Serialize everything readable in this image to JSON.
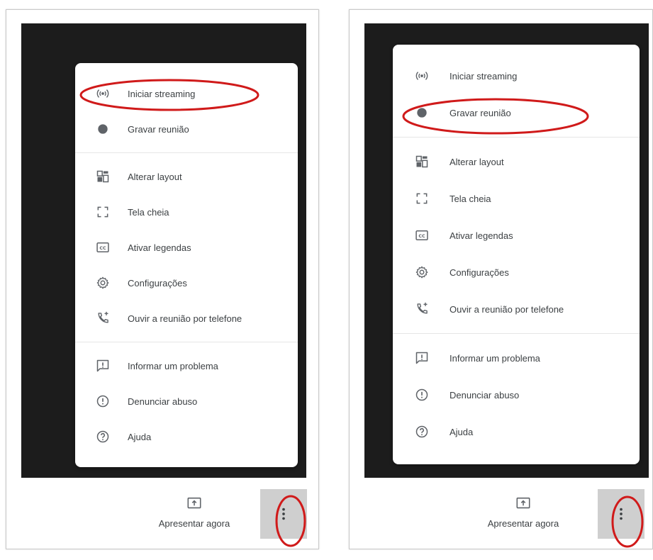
{
  "colors": {
    "video_bg": "#1c1c1c",
    "menu_bg": "#ffffff",
    "text": "#3c4043",
    "annotation": "#d01a1a",
    "more_button_bg": "#cfcfcf"
  },
  "panels": [
    {
      "menu": {
        "group1": [
          {
            "label": "Iniciar streaming",
            "icon": "streaming-icon"
          },
          {
            "label": "Gravar reunião",
            "icon": "record-icon"
          }
        ],
        "group2": [
          {
            "label": "Alterar layout",
            "icon": "layout-icon"
          },
          {
            "label": "Tela cheia",
            "icon": "fullscreen-icon"
          },
          {
            "label": "Ativar legendas",
            "icon": "captions-icon"
          },
          {
            "label": "Configurações",
            "icon": "settings-icon"
          },
          {
            "label": "Ouvir a reunião por telefone",
            "icon": "phone-icon"
          }
        ],
        "group3": [
          {
            "label": "Informar um problema",
            "icon": "feedback-icon"
          },
          {
            "label": "Denunciar abuso",
            "icon": "report-icon"
          },
          {
            "label": "Ajuda",
            "icon": "help-icon"
          }
        ]
      },
      "present_label": "Apresentar agora",
      "highlighted_item": "Iniciar streaming"
    },
    {
      "menu": {
        "group1": [
          {
            "label": "Iniciar streaming",
            "icon": "streaming-icon"
          },
          {
            "label": "Gravar reunião",
            "icon": "record-icon"
          }
        ],
        "group2": [
          {
            "label": "Alterar layout",
            "icon": "layout-icon"
          },
          {
            "label": "Tela cheia",
            "icon": "fullscreen-icon"
          },
          {
            "label": "Ativar legendas",
            "icon": "captions-icon"
          },
          {
            "label": "Configurações",
            "icon": "settings-icon"
          },
          {
            "label": "Ouvir a reunião por telefone",
            "icon": "phone-icon"
          }
        ],
        "group3": [
          {
            "label": "Informar um problema",
            "icon": "feedback-icon"
          },
          {
            "label": "Denunciar abuso",
            "icon": "report-icon"
          },
          {
            "label": "Ajuda",
            "icon": "help-icon"
          }
        ]
      },
      "present_label": "Apresentar agora",
      "highlighted_item": "Gravar reunião"
    }
  ]
}
